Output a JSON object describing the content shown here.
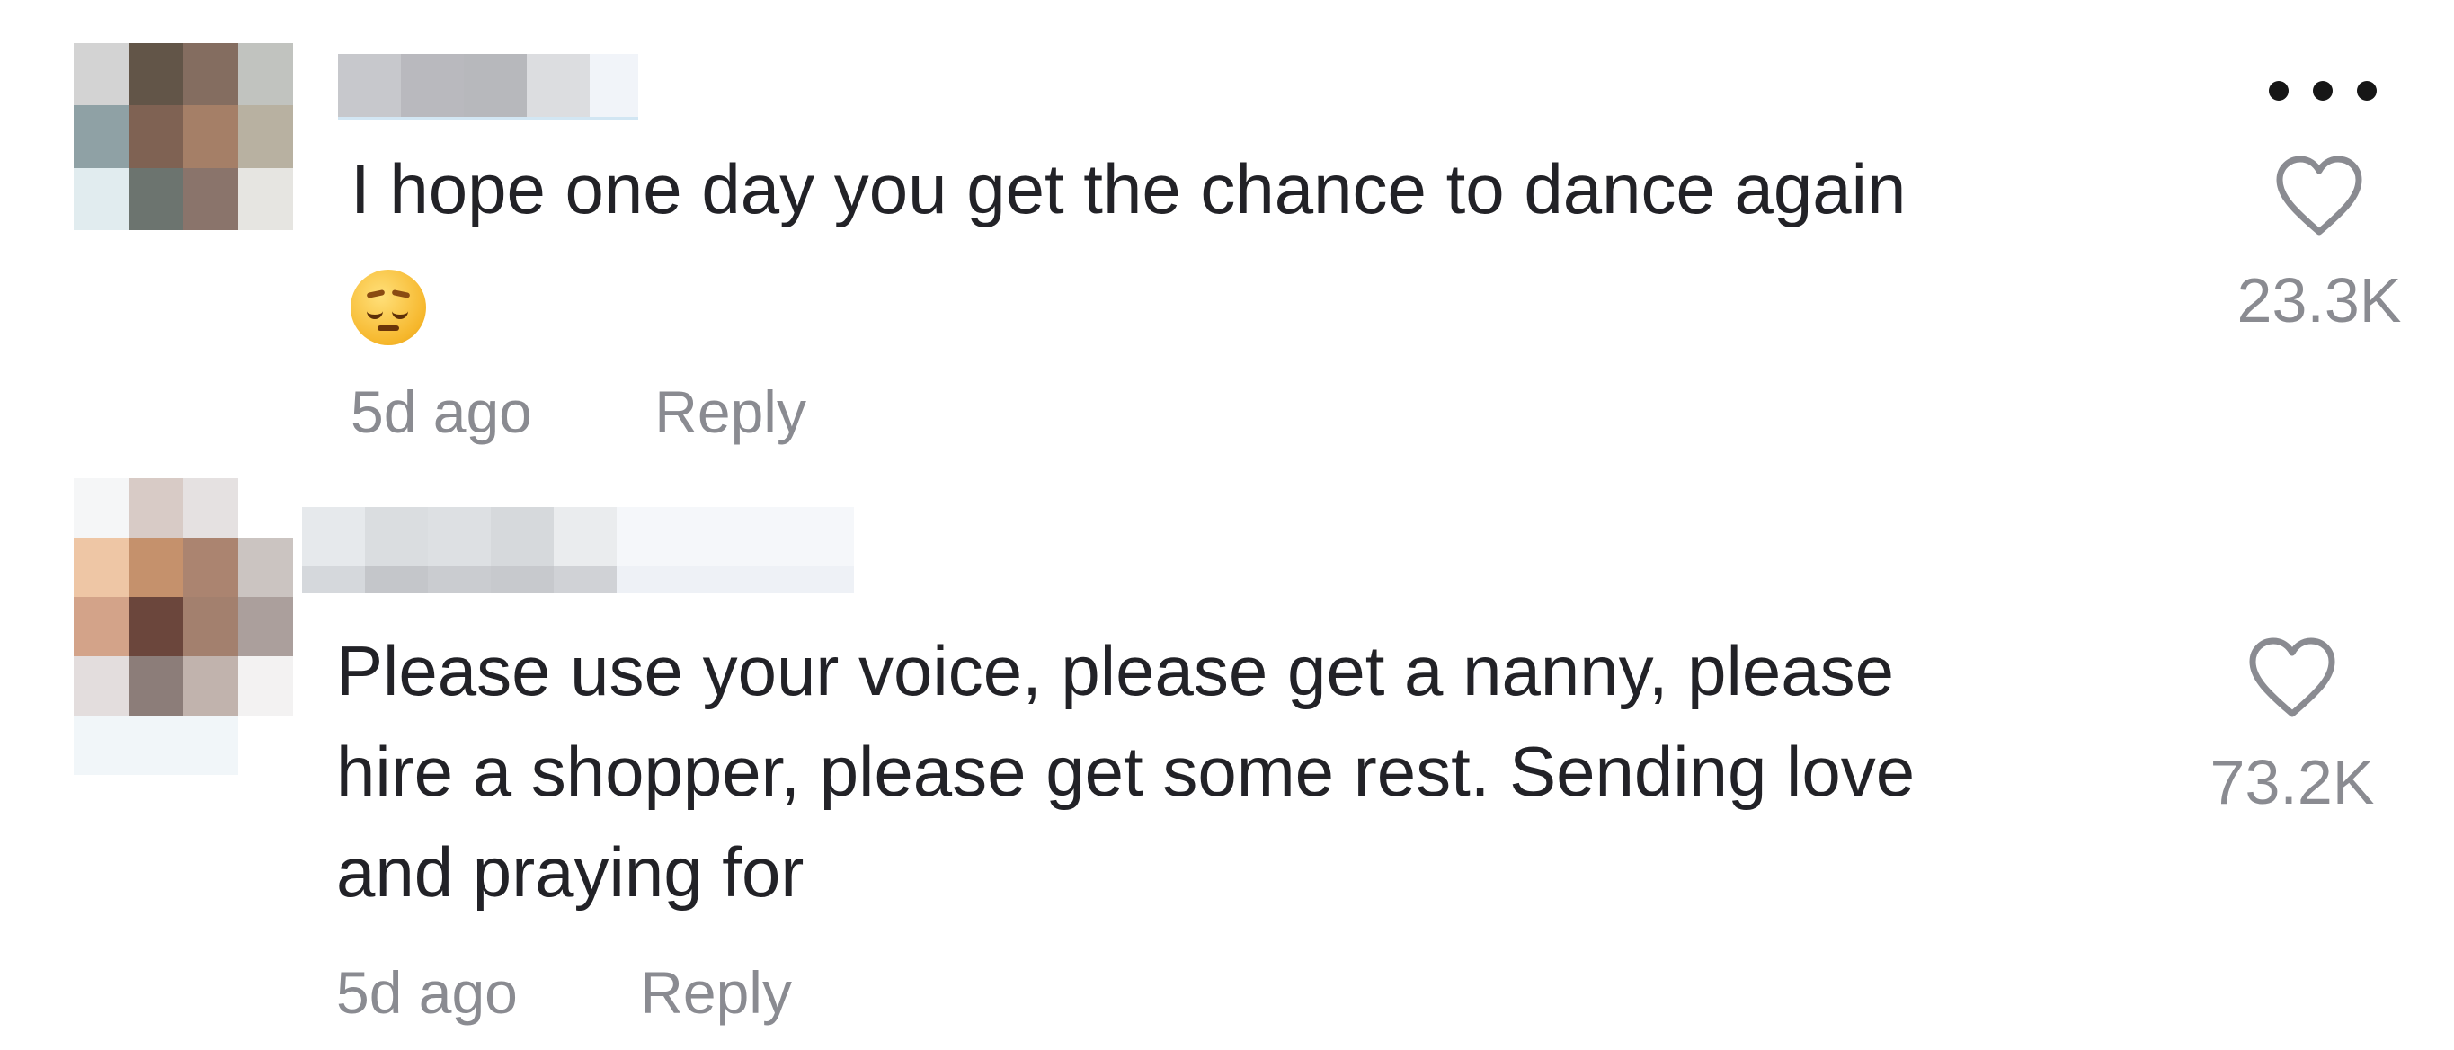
{
  "comments": [
    {
      "text_lines": [
        "I hope one day you get the chance to dance again"
      ],
      "emoji": "pensive-face",
      "time": "5d ago",
      "reply_label": "Reply",
      "likes": "23.3K",
      "avatar_colors": [
        "#d3d3d3",
        "#625548",
        "#846d60",
        "#c1c3bf",
        "#8fa1a5",
        "#7f6253",
        "#a57f67",
        "#b8b1a1",
        "#e1ecef",
        "#6c746f",
        "#8a746b",
        "#e6e5e1"
      ]
    },
    {
      "text_lines": [
        "Please use your voice, please get a nanny, please",
        "hire a shopper, please get some rest. Sending love",
        "and praying for"
      ],
      "time": "5d ago",
      "reply_label": "Reply",
      "likes": "73.2K",
      "avatar_colors": [
        "#f5f6f7",
        "#d8cbc6",
        "#e5e1e1",
        "#ffffff",
        "#eec6a5",
        "#c5916c",
        "#ab8470",
        "#cbc4c1",
        "#d3a389",
        "#6b463c",
        "#a3806e",
        "#ab9f9c",
        "#e3dddd",
        "#8c7d79",
        "#c1b3ad",
        "#f3f2f2",
        "#f1f6f9",
        "#f1f6f9",
        "#f1f6f9",
        "#ffffff"
      ]
    }
  ]
}
